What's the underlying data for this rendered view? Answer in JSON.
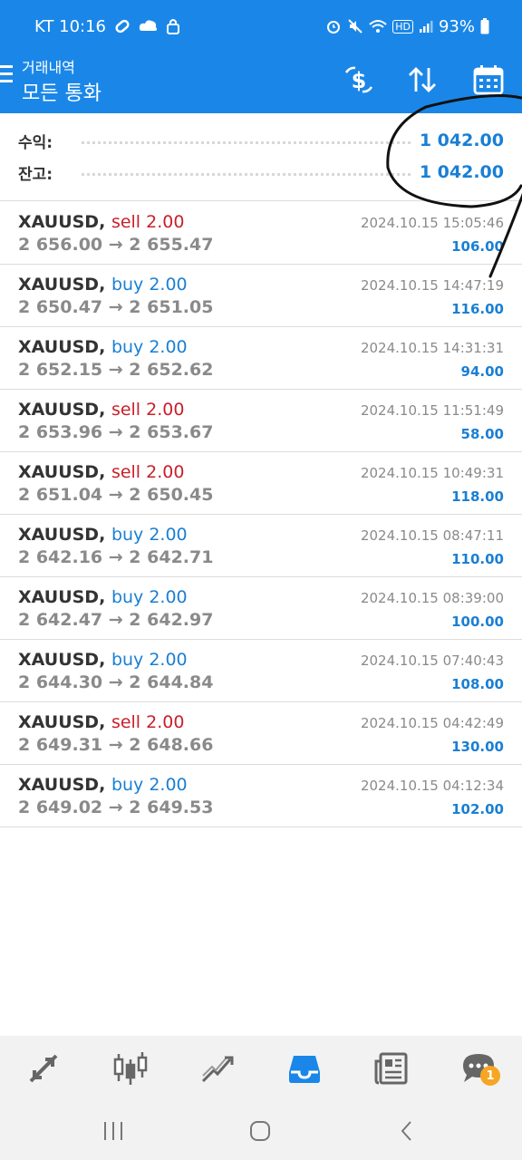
{
  "status_bar": {
    "carrier_time": "KT 10:16",
    "battery": "93%",
    "hd": "HD"
  },
  "app_bar": {
    "subtitle": "거래내역",
    "title": "모든 통화"
  },
  "summary": {
    "profit_label": "수익:",
    "profit_value": "1 042.00",
    "balance_label": "잔고:",
    "balance_value": "1 042.00"
  },
  "trades": [
    {
      "symbol": "XAUUSD,",
      "side": "sell 2.00",
      "prices": "2 656.00 → 2 655.47",
      "time": "2024.10.15 15:05:46",
      "profit": "106.00"
    },
    {
      "symbol": "XAUUSD,",
      "side": "buy 2.00",
      "prices": "2 650.47 → 2 651.05",
      "time": "2024.10.15 14:47:19",
      "profit": "116.00"
    },
    {
      "symbol": "XAUUSD,",
      "side": "buy 2.00",
      "prices": "2 652.15 → 2 652.62",
      "time": "2024.10.15 14:31:31",
      "profit": "94.00"
    },
    {
      "symbol": "XAUUSD,",
      "side": "sell 2.00",
      "prices": "2 653.96 → 2 653.67",
      "time": "2024.10.15 11:51:49",
      "profit": "58.00"
    },
    {
      "symbol": "XAUUSD,",
      "side": "sell 2.00",
      "prices": "2 651.04 → 2 650.45",
      "time": "2024.10.15 10:49:31",
      "profit": "118.00"
    },
    {
      "symbol": "XAUUSD,",
      "side": "buy 2.00",
      "prices": "2 642.16 → 2 642.71",
      "time": "2024.10.15 08:47:11",
      "profit": "110.00"
    },
    {
      "symbol": "XAUUSD,",
      "side": "buy 2.00",
      "prices": "2 642.47 → 2 642.97",
      "time": "2024.10.15 08:39:00",
      "profit": "100.00"
    },
    {
      "symbol": "XAUUSD,",
      "side": "buy 2.00",
      "prices": "2 644.30 → 2 644.84",
      "time": "2024.10.15 07:40:43",
      "profit": "108.00"
    },
    {
      "symbol": "XAUUSD,",
      "side": "sell 2.00",
      "prices": "2 649.31 → 2 648.66",
      "time": "2024.10.15 04:42:49",
      "profit": "130.00"
    },
    {
      "symbol": "XAUUSD,",
      "side": "buy 2.00",
      "prices": "2 649.02 → 2 649.53",
      "time": "2024.10.15 04:12:34",
      "profit": "102.00"
    }
  ],
  "bottom_nav": {
    "items": [
      "quotes-icon",
      "chart-icon",
      "trade-icon",
      "history-icon",
      "news-icon",
      "chat-icon"
    ],
    "active": "history-icon",
    "chat_badge": "1"
  },
  "colors": {
    "primary": "#1a87e8",
    "sell": "#c8202a",
    "buy": "#1a7fd4",
    "badge": "#f5a623"
  }
}
